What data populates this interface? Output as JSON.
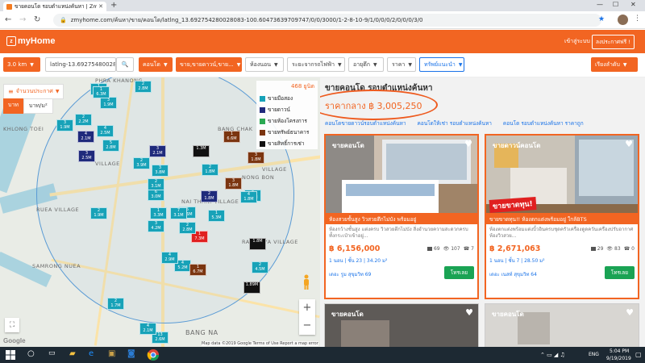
{
  "browser": {
    "tab_title": "ขายคอนโด รอบตำแหน่งค้นหา | Zmy...",
    "url": "zmyhome.com/ค้นหา/ขาย/คอนโด/latlng_13.692754280028083-100.60473639709747/0/0/3000/1-2-8-10-9/1/0/0/0/2/0/0/0/3/0"
  },
  "header": {
    "logo_text": "myHome",
    "login": "เข้าสู่ระบบ",
    "post_free": "ลงประกาศฟรี !"
  },
  "filters": {
    "distance": "3.0 km",
    "location": "latlng-13.6927548002800",
    "type": "คอนโด",
    "sale_status": "ขาย,ขายดาวน์,ขาย...",
    "bedrooms": "ห้องนอน",
    "transit": "ระยะจากรถไฟฟ้า",
    "building_age": "อายุตึก",
    "price": "ราคา",
    "recommended": "ทรัพย์แนะนำ",
    "sort": "เรียงลำดับ"
  },
  "map": {
    "toggle": "จำนวนประกาศ",
    "unit_baht": "บาท",
    "unit_sqm": "บาท/ม²",
    "legend_count": "468 ยูนิต",
    "legend": [
      {
        "label": "ขายมือสอง",
        "color": "#17a2b8"
      },
      {
        "label": "ขายดาวน์",
        "color": "#1f2a7c"
      },
      {
        "label": "ขายห้องโครงการ",
        "color": "#2aa952"
      },
      {
        "label": "ขายทรัพย์ธนาคาร",
        "color": "#7b3510"
      },
      {
        "label": "ขายสิทธิ์การเช่า",
        "color": "#111111"
      }
    ],
    "labels": {
      "phra_khanong": "PHRA KHANONG",
      "khlong_toei": "KHLONG TOEI",
      "bang_chak": "BANG CHAK",
      "village1": "VILLAGE",
      "village2": "VILLAGE",
      "nong_bon": "NONG BON",
      "bang_na": "BANG NA",
      "rangsiya_village": "RANGSIYA VILLAGE",
      "nai_thani_village": "NAI THANI VILLAGE",
      "ruea_village": "RUEA VILLAGE",
      "samrong_nuea": "SAMRONG NUEA",
      "google": "Google",
      "attribution": "Map data ©2019 Google   Terms of Use   Report a map error"
    },
    "pins": [
      {
        "c": "teal",
        "n": "1",
        "p": "3.8M"
      },
      {
        "c": "teal",
        "n": "2",
        "p": "2.8M"
      },
      {
        "c": "teal",
        "n": "3",
        "p": "1.9M"
      },
      {
        "c": "teal",
        "n": "1",
        "p": "6.3M"
      },
      {
        "c": "teal",
        "n": "2",
        "p": "2.2M"
      },
      {
        "c": "teal",
        "n": "3",
        "p": "1.9M"
      },
      {
        "c": "teal",
        "n": "4",
        "p": "2.5M"
      },
      {
        "c": "navy",
        "n": "4",
        "p": "2.1M"
      },
      {
        "c": "navy",
        "n": "3",
        "p": "2.5M"
      },
      {
        "c": "teal",
        "n": "5",
        "p": "2.8M"
      },
      {
        "c": "teal",
        "n": "2",
        "p": "3.9M"
      },
      {
        "c": "brown",
        "n": "1",
        "p": "6.6M"
      },
      {
        "c": "brown",
        "n": "3",
        "p": "1.8M"
      },
      {
        "c": "brown",
        "n": "3",
        "p": "1.8M"
      },
      {
        "c": "teal",
        "n": "6",
        "p": "3.0M"
      },
      {
        "c": "teal",
        "n": "3",
        "p": "3.8M"
      },
      {
        "c": "teal",
        "n": "2",
        "p": "3.1M"
      },
      {
        "c": "black",
        "n": "",
        "p": "1.3M"
      },
      {
        "c": "teal",
        "n": "2",
        "p": "1.8M"
      },
      {
        "c": "teal",
        "n": "1",
        "p": "3.3M"
      },
      {
        "c": "red",
        "n": "1",
        "p": "7.3M"
      },
      {
        "c": "teal",
        "n": "5",
        "p": "2.6M"
      },
      {
        "c": "teal",
        "n": "3",
        "p": "4.2M"
      },
      {
        "c": "teal",
        "n": "2",
        "p": "1.8M"
      },
      {
        "c": "teal",
        "n": "2",
        "p": "1.9M"
      },
      {
        "c": "teal",
        "n": "7",
        "p": "3.1M"
      },
      {
        "c": "teal",
        "n": "4",
        "p": "5.2M"
      },
      {
        "c": "black",
        "n": "",
        "p": "1.8M"
      },
      {
        "c": "brown",
        "n": "1",
        "p": "6.7M"
      },
      {
        "c": "teal",
        "n": "2",
        "p": "1.7M"
      },
      {
        "c": "teal",
        "n": "4",
        "p": "2.9M"
      },
      {
        "c": "teal",
        "n": "13",
        "p": "2.6M"
      },
      {
        "c": "teal",
        "n": "4",
        "p": "2.1M"
      },
      {
        "c": "teal",
        "n": "2",
        "p": "2.8M"
      },
      {
        "c": "teal",
        "n": "1",
        "p": "5.3M"
      },
      {
        "c": "navy",
        "n": "3",
        "p": "2.1M"
      },
      {
        "c": "teal",
        "n": "4",
        "p": "1.8M"
      },
      {
        "c": "black",
        "n": "",
        "p": "1.89M"
      },
      {
        "c": "teal",
        "n": "2",
        "p": "4.5M"
      },
      {
        "c": "navy",
        "n": "2",
        "p": "1.8M"
      }
    ]
  },
  "panel": {
    "title": "ขายคอนโด รอบตำแหน่งค้นหา",
    "median": "ราคากลาง ฿ 3,005,250",
    "links": [
      "คอนโดขายดาวน์รอบตำแหน่งค้นหา",
      "คอนโดให้เช่า รอบตำแหน่งค้นหา",
      "คอนโด รอบตำแหน่งค้นหา ราคาถูก"
    ]
  },
  "cards": [
    {
      "tag": "ขายคอนโด",
      "banner": "ห้องสวยชั้นสูง วิวสวยตึกไม่บัง พร้อมอยู่",
      "desc": "ห้องกว้างชั้นสูง แต่งครบ วิวสวยตึกไม่บัง สิ่งอำนวยความสะดวกครบ ทั้งกระเป๋าเข้าอยู่...",
      "price": "฿ 6,156,000",
      "photos": "69",
      "views": "107",
      "calls": "7",
      "meta": "1 นอน | ชั้น 23 | 34.20 ม²",
      "loc": "เดอะ รูม สุขุมวิท 69",
      "call_btn": "โทรเลย"
    },
    {
      "tag": "ขายดาวน์คอนโด",
      "ribbon": "ขายขาดทุน!",
      "banner": "ขายขาดทุน!! ห้องตกแต่งพร้อมอยู่ ใกล้BTS",
      "desc": "ห้องตกแต่งพร้อมแต่งบิ้วอินครบชุดครัวเครื่องดูดควันเครื่องปรับอากาศ ห้องวิวสวย...",
      "price": "฿ 2,671,063",
      "photos": "29",
      "views": "83",
      "calls": "0",
      "meta": "1 นอน | ชั้น 7 | 28.50 ม²",
      "loc": "เดอะ เนสท์ สุขุมวิท 64",
      "call_btn": "โทรเลย"
    }
  ],
  "more_cards": [
    {
      "tag": "ขายคอนโด"
    },
    {
      "tag": "ขายคอนโด"
    }
  ],
  "taskbar": {
    "time": "5:04 PM",
    "date": "9/19/2019",
    "lang": "ENG"
  }
}
